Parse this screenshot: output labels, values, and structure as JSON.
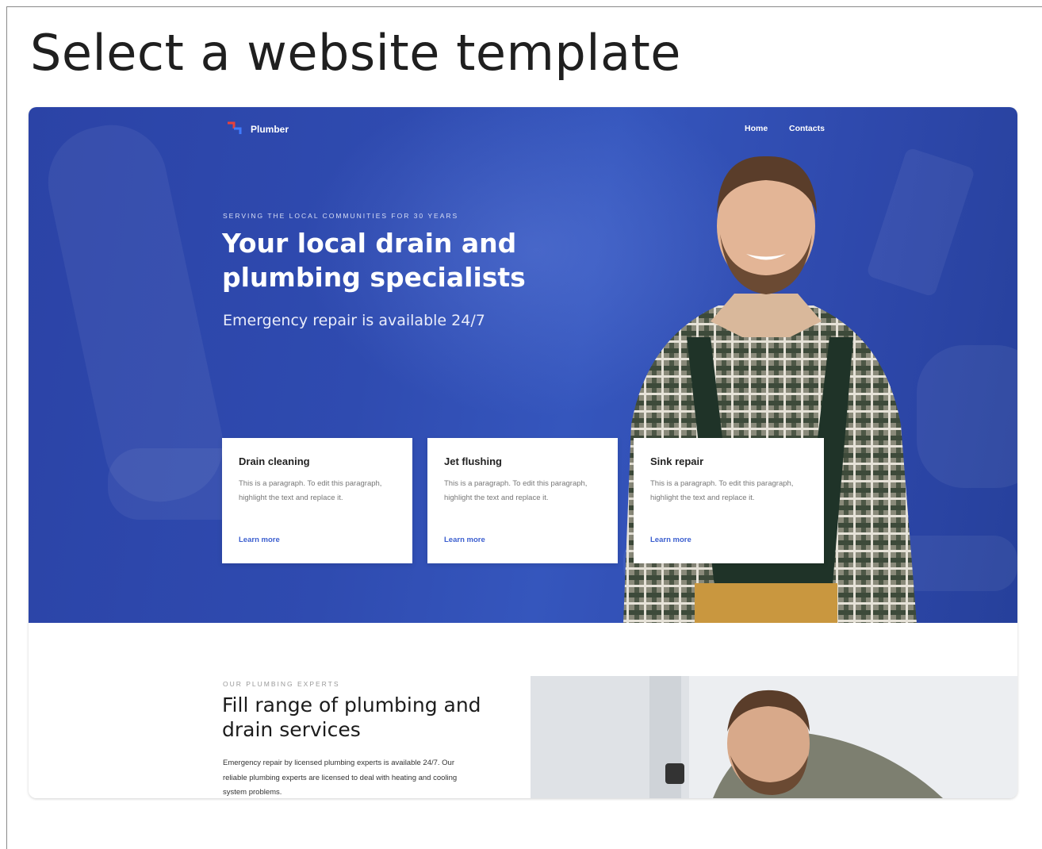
{
  "page": {
    "heading": "Select a website template"
  },
  "template": {
    "logo_text": "Plumber",
    "nav": [
      "Home",
      "Contacts"
    ],
    "hero": {
      "eyebrow": "SERVING THE LOCAL COMMUNITIES FOR 30 YEARS",
      "headline": "Your local drain and plumbing specialists",
      "subheadline": "Emergency repair is available 24/7"
    },
    "services": [
      {
        "title": "Drain cleaning",
        "text": "This is a paragraph. To edit this paragraph, highlight the text and replace it.",
        "link": "Learn more"
      },
      {
        "title": "Jet flushing",
        "text": "This is a paragraph. To edit this paragraph, highlight the text and replace it.",
        "link": "Learn more"
      },
      {
        "title": "Sink repair",
        "text": "This is a paragraph. To edit this paragraph, highlight the text and replace it.",
        "link": "Learn more"
      }
    ],
    "section2": {
      "eyebrow": "OUR PLUMBING EXPERTS",
      "title": "Fill range of plumbing and drain services",
      "text": "Emergency repair by licensed plumbing experts is available 24/7. Our reliable plumbing experts are licensed to deal with heating and cooling system problems."
    }
  },
  "colors": {
    "hero_blue": "#2f4bb0",
    "link_blue": "#3c5fcf",
    "logo_red": "#e8413a",
    "logo_blue": "#3f7bff"
  },
  "icons": {
    "logo": "pipe-logo-icon"
  }
}
